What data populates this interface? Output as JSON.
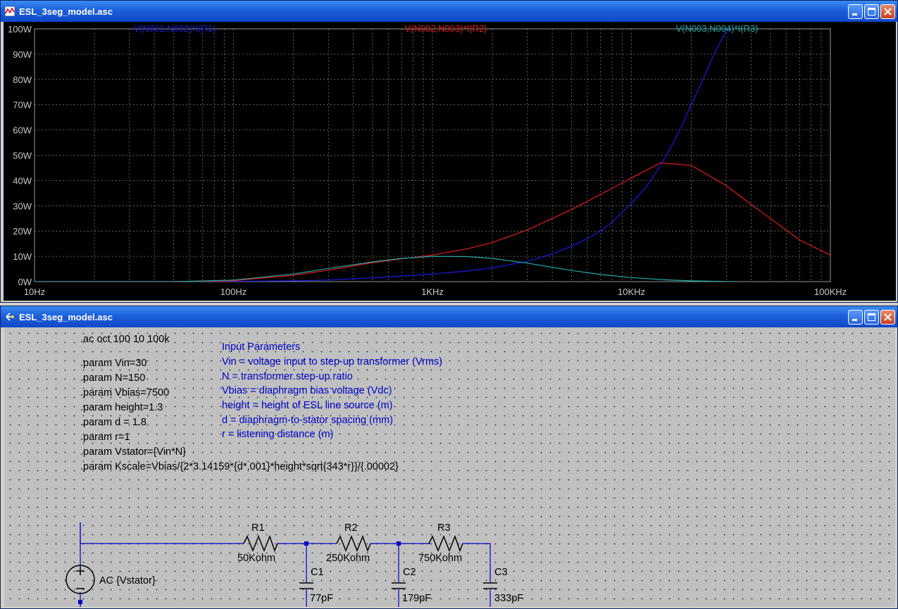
{
  "plot_window": {
    "title": "ESL_3seg_model.asc",
    "traces": [
      {
        "label": "V(N001,N002)*I(R1)",
        "color": "#1a1ae8"
      },
      {
        "label": "V(N002,N003)*I(R2)",
        "color": "#e81a1a"
      },
      {
        "label": "V(N003,N004)*I(R3)",
        "color": "#20a8a8"
      }
    ]
  },
  "chart_data": {
    "type": "line",
    "xscale": "log",
    "xlim": [
      10,
      100000
    ],
    "ylim": [
      0,
      100
    ],
    "x_ticks": [
      "10Hz",
      "100Hz",
      "1KHz",
      "10KHz",
      "100KHz"
    ],
    "y_ticks": [
      "0W",
      "10W",
      "20W",
      "30W",
      "40W",
      "50W",
      "60W",
      "70W",
      "80W",
      "90W",
      "100W"
    ],
    "grid": true,
    "series": [
      {
        "name": "V(N001,N002)*I(R1)",
        "color": "#1a1ae8",
        "x": [
          10,
          50,
          100,
          200,
          300,
          500,
          700,
          1000,
          1500,
          2000,
          3000,
          4000,
          5000,
          6000,
          7000,
          8000,
          10000,
          12000,
          14000,
          16000,
          18000,
          20000,
          22000,
          25000,
          28000,
          30000,
          31000
        ],
        "y": [
          0,
          0,
          0.1,
          0.3,
          0.6,
          1.5,
          2.2,
          3,
          4.2,
          5.5,
          8,
          11,
          14,
          17,
          20,
          23.5,
          31,
          38,
          46,
          54,
          62,
          70,
          77,
          87,
          95,
          99,
          100
        ]
      },
      {
        "name": "V(N002,N003)*I(R2)",
        "color": "#e81a1a",
        "x": [
          50,
          100,
          200,
          300,
          500,
          700,
          1000,
          1500,
          2000,
          3000,
          4000,
          5000,
          7000,
          10000,
          14000,
          20000,
          30000,
          40000,
          50000,
          70000,
          100000
        ],
        "y": [
          0,
          0.4,
          2.5,
          4.5,
          7.5,
          9,
          10.5,
          13,
          15.5,
          20.5,
          25,
          28.5,
          34.5,
          41,
          47,
          46,
          38,
          30.5,
          25,
          16.5,
          10.5
        ]
      },
      {
        "name": "V(N003,N004)*I(R3)",
        "color": "#20a8a8",
        "x": [
          10,
          50,
          100,
          200,
          300,
          500,
          700,
          1000,
          1500,
          2000,
          3000,
          5000,
          7000,
          10000,
          15000,
          20000,
          30000,
          35000
        ],
        "y": [
          0,
          0,
          0.6,
          3,
          5.2,
          7.8,
          9.2,
          10,
          9.9,
          9.2,
          7.3,
          4.4,
          2.8,
          1.6,
          0.7,
          0.3,
          0.05,
          0
        ]
      }
    ]
  },
  "schematic_window": {
    "title": "ESL_3seg_model.asc",
    "directives": [
      ".ac oct 100 10 100k",
      ".param Vin=30",
      ".param N=150",
      ".param Vbias=7500",
      ".param height=1.3",
      ".param d = 1.8",
      ".param r=1",
      ".param Vstator={Vin*N}",
      ".param Kscale=Vbias/{2*3.14159*{d*.001}*height*sqrt{343*r}}/{.00002}"
    ],
    "comments": [
      "Input Parameters",
      "Vin = voltage input to step-up transformer (Vrms)",
      "N = transformer step-up ratio",
      "Vbias = diaphragm bias voltage (Vdc)",
      "height = height of ESL line source (m)",
      "d = diaphragm-to-stator spacing (mm)",
      "r = listening distance (m)"
    ],
    "components": {
      "source_label": "AC {Vstator}",
      "r1_name": "R1",
      "r1_value": "50Kohm",
      "r2_name": "R2",
      "r2_value": "250Kohm",
      "r3_name": "R3",
      "r3_value": "750Kohm",
      "c1_name": "C1",
      "c1_value": "77pF",
      "c2_name": "C2",
      "c2_value": "179pF",
      "c3_name": "C3",
      "c3_value": "333pF"
    },
    "wire_color": "#0000c8"
  }
}
